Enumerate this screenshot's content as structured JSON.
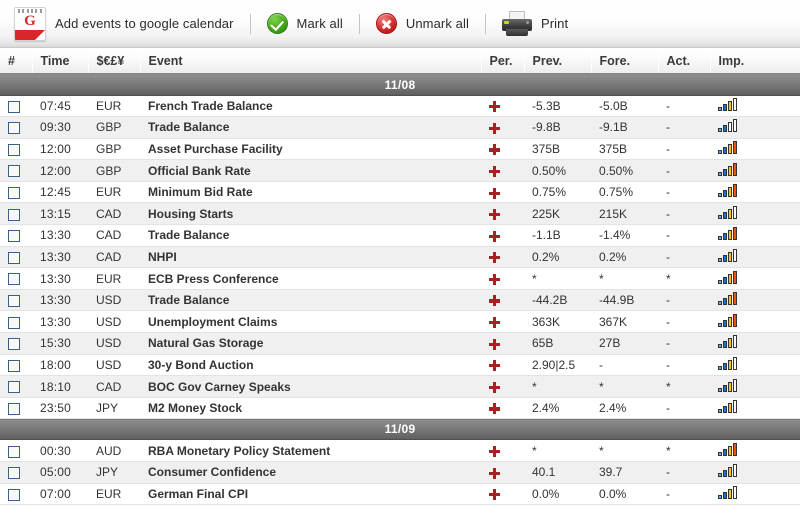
{
  "toolbar": {
    "items": [
      {
        "icon": "google-calendar-icon",
        "label": "Add events to google calendar"
      },
      {
        "icon": "green-check-icon",
        "label": "Mark all"
      },
      {
        "icon": "red-x-icon",
        "label": "Unmark all"
      },
      {
        "icon": "printer-icon",
        "label": "Print"
      }
    ],
    "gcal_letter": "G"
  },
  "table": {
    "columns": [
      {
        "key": "num",
        "label": "#"
      },
      {
        "key": "time",
        "label": "Time"
      },
      {
        "key": "cur",
        "label": "$€£¥"
      },
      {
        "key": "event",
        "label": "Event"
      },
      {
        "key": "per",
        "label": "Per."
      },
      {
        "key": "prev",
        "label": "Prev."
      },
      {
        "key": "fore",
        "label": "Fore."
      },
      {
        "key": "act",
        "label": "Act."
      },
      {
        "key": "imp",
        "label": "Imp."
      }
    ],
    "groups": [
      {
        "date": "11/08",
        "rows": [
          {
            "time": "07:45",
            "cur": "EUR",
            "event": "French Trade Balance",
            "per": "plus-icon",
            "prev": "-5.3B",
            "fore": "-5.0B",
            "act": "-",
            "imp": 3
          },
          {
            "time": "09:30",
            "cur": "GBP",
            "event": "Trade Balance",
            "per": "plus-icon",
            "prev": "-9.8B",
            "fore": "-9.1B",
            "act": "-",
            "imp": 2
          },
          {
            "time": "12:00",
            "cur": "GBP",
            "event": "Asset Purchase Facility",
            "per": "plus-icon",
            "prev": "375B",
            "fore": "375B",
            "act": "-",
            "imp": 4
          },
          {
            "time": "12:00",
            "cur": "GBP",
            "event": "Official Bank Rate",
            "per": "plus-icon",
            "prev": "0.50%",
            "fore": "0.50%",
            "act": "-",
            "imp": 4
          },
          {
            "time": "12:45",
            "cur": "EUR",
            "event": "Minimum Bid Rate",
            "per": "plus-icon",
            "prev": "0.75%",
            "fore": "0.75%",
            "act": "-",
            "imp": 4
          },
          {
            "time": "13:15",
            "cur": "CAD",
            "event": "Housing Starts",
            "per": "plus-icon",
            "prev": "225K",
            "fore": "215K",
            "act": "-",
            "imp": 3
          },
          {
            "time": "13:30",
            "cur": "CAD",
            "event": "Trade Balance",
            "per": "plus-icon",
            "prev": "-1.1B",
            "fore": "-1.4%",
            "act": "-",
            "imp": 4
          },
          {
            "time": "13:30",
            "cur": "CAD",
            "event": "NHPI",
            "per": "plus-icon",
            "prev": "0.2%",
            "fore": "0.2%",
            "act": "-",
            "imp": 3
          },
          {
            "time": "13:30",
            "cur": "EUR",
            "event": "ECB Press Conference",
            "per": "plus-icon",
            "prev": "*",
            "fore": "*",
            "act": "*",
            "imp": 4
          },
          {
            "time": "13:30",
            "cur": "USD",
            "event": "Trade Balance",
            "per": "plus-icon",
            "prev": "-44.2B",
            "fore": "-44.9B",
            "act": "-",
            "imp": 4
          },
          {
            "time": "13:30",
            "cur": "USD",
            "event": "Unemployment Claims",
            "per": "plus-icon",
            "prev": "363K",
            "fore": "367K",
            "act": "-",
            "imp": 4
          },
          {
            "time": "15:30",
            "cur": "USD",
            "event": "Natural Gas Storage",
            "per": "plus-icon",
            "prev": "65B",
            "fore": "27B",
            "act": "-",
            "imp": 3
          },
          {
            "time": "18:00",
            "cur": "USD",
            "event": "30-y Bond Auction",
            "per": "plus-icon",
            "prev": "2.90|2.5",
            "fore": "-",
            "act": "-",
            "imp": 3
          },
          {
            "time": "18:10",
            "cur": "CAD",
            "event": "BOC Gov Carney Speaks",
            "per": "plus-icon",
            "prev": "*",
            "fore": "*",
            "act": "*",
            "imp": 3
          },
          {
            "time": "23:50",
            "cur": "JPY",
            "event": "M2 Money Stock",
            "per": "plus-icon",
            "prev": "2.4%",
            "fore": "2.4%",
            "act": "-",
            "imp": 3
          }
        ]
      },
      {
        "date": "11/09",
        "rows": [
          {
            "time": "00:30",
            "cur": "AUD",
            "event": "RBA Monetary Policy Statement",
            "per": "plus-icon",
            "prev": "*",
            "fore": "*",
            "act": "*",
            "imp": 4
          },
          {
            "time": "05:00",
            "cur": "JPY",
            "event": "Consumer Confidence",
            "per": "plus-icon",
            "prev": "40.1",
            "fore": "39.7",
            "act": "-",
            "imp": 3
          },
          {
            "time": "07:00",
            "cur": "EUR",
            "event": "German Final CPI",
            "per": "plus-icon",
            "prev": "0.0%",
            "fore": "0.0%",
            "act": "-",
            "imp": 3
          }
        ]
      }
    ]
  },
  "colors": {
    "date_header_bg": "#6e6e6e",
    "plus_red": "#a82020",
    "bar_low": "#5fb3e8",
    "bar_mid": "#1a73d0",
    "bar_high": "#ffc40d",
    "bar_top": "#f4500f",
    "checkbox_border": "#3a5f87"
  }
}
